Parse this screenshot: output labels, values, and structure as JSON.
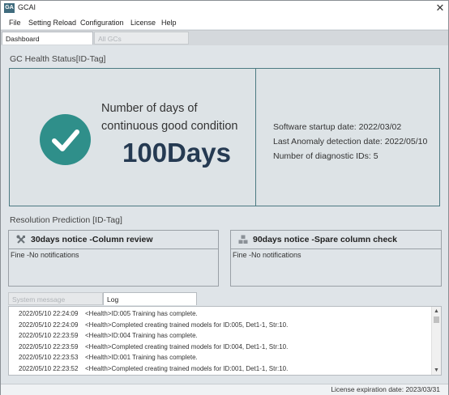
{
  "window": {
    "app_icon": "GA",
    "title": "GCAI",
    "close": "✕"
  },
  "menu": [
    "File",
    "Setting Reload",
    "Configuration",
    "License",
    "Help"
  ],
  "tabs": [
    {
      "label": "Dashboard",
      "active": true
    },
    {
      "label": "All GCs",
      "active": false
    }
  ],
  "health": {
    "section_title": "GC Health Status[ID-Tag]",
    "days_label_line1": "Number of days of",
    "days_label_line2": "continuous good condition",
    "days_value": "100Days",
    "startup": "Software startup date:  2022/03/02",
    "last_anomaly": "Last Anomaly detection date:  2022/05/10",
    "diag_ids": "Number of diagnostic IDs:  5",
    "icon": "checkmark-circle-icon",
    "accent": "#2f8f8a"
  },
  "prediction": {
    "section_title": "Resolution Prediction [ID-Tag]",
    "column_review": {
      "title": "30days notice -Column review",
      "icon": "tools-icon",
      "body": "Fine -No notifications"
    },
    "spare_column": {
      "title": "90days notice -Spare column check",
      "icon": "boxes-icon",
      "body": "Fine -No notifications"
    }
  },
  "log": {
    "tabs": [
      {
        "label": "System message",
        "active": false
      },
      {
        "label": "Log",
        "active": true
      }
    ],
    "entries": [
      {
        "ts": "2022/05/10 22:24:09",
        "msg": "<Health>ID:005 Training has complete."
      },
      {
        "ts": "2022/05/10 22:24:09",
        "msg": "<Health>Completed creating trained models for ID:005, Det1-1, Str:10."
      },
      {
        "ts": "2022/05/10 22:23:59",
        "msg": "<Health>ID:004 Training has complete."
      },
      {
        "ts": "2022/05/10 22:23:59",
        "msg": "<Health>Completed creating trained models for ID:004, Det1-1, Str:10."
      },
      {
        "ts": "2022/05/10 22:23:53",
        "msg": "<Health>ID:001 Training has complete."
      },
      {
        "ts": "2022/05/10 22:23:52",
        "msg": "<Health>Completed creating trained models for ID:001, Det1-1, Str:10."
      }
    ]
  },
  "status": {
    "license": "License expiration date: 2023/03/31"
  }
}
